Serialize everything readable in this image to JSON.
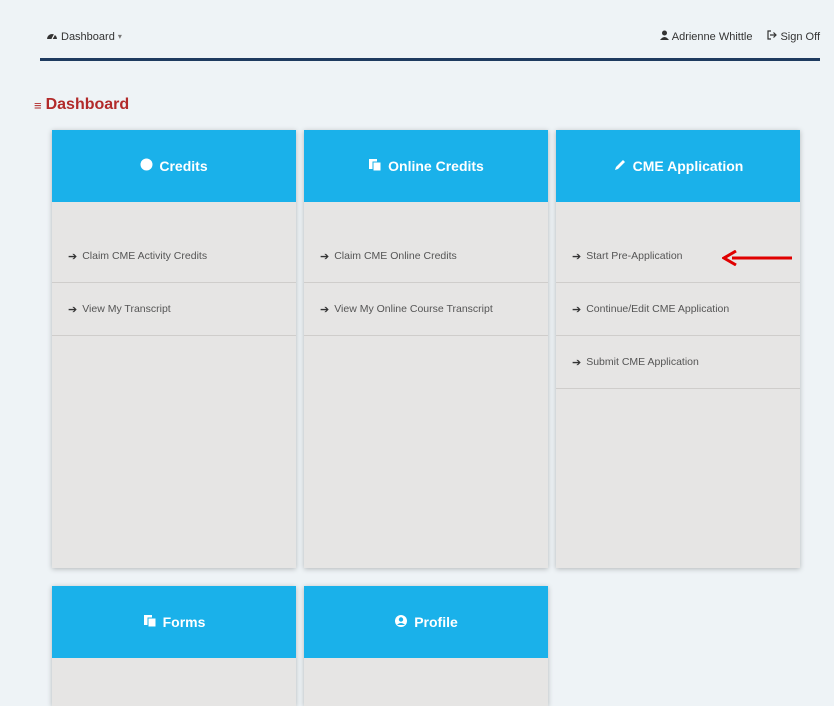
{
  "nav": {
    "dashboard_label": "Dashboard",
    "user_name": "Adrienne Whittle",
    "signoff_label": "Sign Off"
  },
  "page": {
    "title": "Dashboard"
  },
  "cards": [
    {
      "title": "Credits",
      "icon": "circle-icon",
      "links": [
        "Claim CME Activity Credits",
        "View My Transcript"
      ]
    },
    {
      "title": "Online Credits",
      "icon": "copy-icon",
      "links": [
        "Claim CME Online Credits",
        "View My Online Course Transcript"
      ]
    },
    {
      "title": "CME Application",
      "icon": "pencil-icon",
      "links": [
        "Start Pre-Application",
        "Continue/Edit CME Application",
        "Submit CME Application"
      ]
    },
    {
      "title": "Forms",
      "icon": "copy-icon",
      "links": []
    },
    {
      "title": "Profile",
      "icon": "user-circle-icon",
      "links": []
    }
  ],
  "colors": {
    "header": "#1ab1ea",
    "title": "#b22a2a",
    "nav_border": "#1e3a5f",
    "annotation_arrow": "#e00000"
  }
}
